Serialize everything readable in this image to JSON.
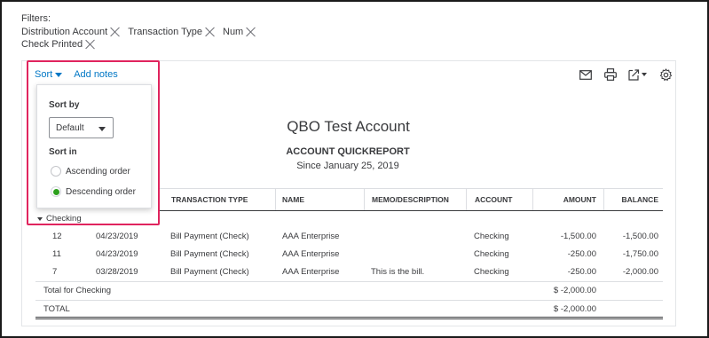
{
  "filters": {
    "label": "Filters:",
    "chips": [
      "Distribution Account",
      "Transaction Type",
      "Num",
      "Check Printed"
    ]
  },
  "toolbar": {
    "sort_label": "Sort",
    "add_notes_label": "Add notes",
    "icons": [
      "email-icon",
      "print-icon",
      "export-icon",
      "settings-icon"
    ]
  },
  "sort_menu": {
    "sort_by_label": "Sort by",
    "sort_by_value": "Default",
    "sort_in_label": "Sort in",
    "ascending_label": "Ascending order",
    "descending_label": "Descending order",
    "selected": "descending"
  },
  "report": {
    "company": "QBO Test Account",
    "title": "ACCOUNT QUICKREPORT",
    "subtitle": "Since January 25, 2019",
    "columns": [
      "TRANSACTION TYPE",
      "NAME",
      "MEMO/DESCRIPTION",
      "ACCOUNT",
      "AMOUNT",
      "BALANCE"
    ],
    "group": "Checking",
    "rows": [
      {
        "num": "12",
        "date": "04/23/2019",
        "type": "Bill Payment (Check)",
        "name": "AAA Enterprise",
        "memo": "",
        "account": "Checking",
        "amount": "-1,500.00",
        "balance": "-1,500.00"
      },
      {
        "num": "11",
        "date": "04/23/2019",
        "type": "Bill Payment (Check)",
        "name": "AAA Enterprise",
        "memo": "",
        "account": "Checking",
        "amount": "-250.00",
        "balance": "-1,750.00"
      },
      {
        "num": "7",
        "date": "03/28/2019",
        "type": "Bill Payment (Check)",
        "name": "AAA Enterprise",
        "memo": "This is the bill.",
        "account": "Checking",
        "amount": "-250.00",
        "balance": "-2,000.00"
      }
    ],
    "group_total_label": "Total for Checking",
    "group_total_amount": "$ -2,000.00",
    "total_label": "TOTAL",
    "total_amount": "$ -2,000.00"
  },
  "colors": {
    "accent": "#0077c5",
    "highlight": "#e0245e",
    "radio_selected": "#2ca01c"
  }
}
